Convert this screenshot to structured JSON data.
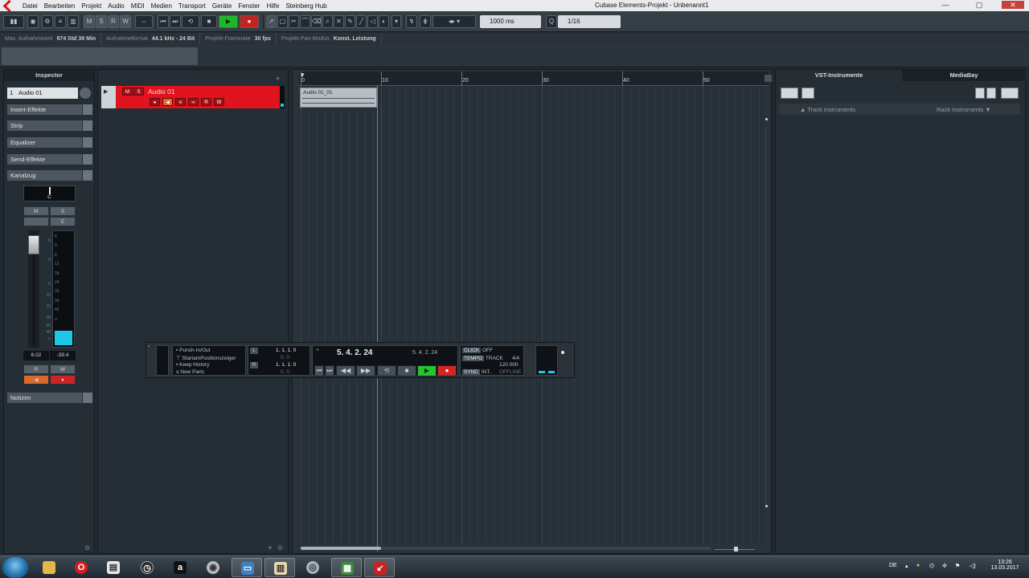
{
  "window": {
    "title": "Cubase Elements-Projekt - Unbenannt1",
    "minimize": "—",
    "maximize": "▢",
    "close": "✕"
  },
  "menu": [
    "Datei",
    "Bearbeiten",
    "Projekt",
    "Audio",
    "MIDI",
    "Medien",
    "Transport",
    "Geräte",
    "Fenster",
    "Hilfe",
    "Steinberg Hub"
  ],
  "toolbar": {
    "m": "M",
    "s": "S",
    "r": "R",
    "w": "W",
    "tempo_field": "1000 ms",
    "quantize_field": "1/16",
    "quantize_icon": "Q"
  },
  "status": [
    {
      "label": "Max. Aufnahmezeit",
      "value": "974 Std 39 Min"
    },
    {
      "label": "Aufnahmeformat",
      "value": "44.1 kHz - 24 Bit"
    },
    {
      "label": "Projekt-Framerate",
      "value": "30 fps"
    },
    {
      "label": "Projekt-Pan-Modus",
      "value": "Konst. Leistung"
    }
  ],
  "inspector": {
    "title": "Inspector",
    "track_number": "1",
    "track_name": "Audio 01",
    "sections": [
      "Insert-Effekte",
      "Strip",
      "Equalizer",
      "Send-Effekte",
      "Kanalzug"
    ],
    "pan_value": "C",
    "m": "M",
    "s": "S",
    "e": "E",
    "scale": [
      "6",
      "0",
      "6",
      "12",
      "18",
      "24",
      "30",
      "36",
      "42",
      "∞"
    ],
    "left_scale": [
      "6",
      "0",
      "5",
      "10",
      "15",
      "20",
      "30",
      "40",
      "∞"
    ],
    "volume": "6.02",
    "peak": "-39.4",
    "r": "R",
    "w": "W",
    "notes": "Notizen"
  },
  "track": {
    "name": "Audio 01",
    "m": "M",
    "s": "S",
    "r": "R",
    "w": "W"
  },
  "ruler": {
    "ticks": [
      "0",
      "10",
      "20",
      "30",
      "40",
      "50"
    ]
  },
  "clip": {
    "name": "Audio 01_01"
  },
  "rightzone": {
    "tabs": [
      "VST-Instrumente",
      "MediaBay"
    ],
    "track_instruments": "▲ Track Instruments",
    "rack_instruments": "Rack Instruments ▼"
  },
  "transport": {
    "options": [
      "Punch-In/Out",
      "StartamPositionszeiger",
      "Keep History",
      "New Parts"
    ],
    "left_locator": "1. 1. 1.   0",
    "left_locator_sub": "0.    0",
    "right_locator": "1. 1. 1.   0",
    "right_locator_sub": "0.    0",
    "l": "L",
    "r": "R",
    "position": "5. 4. 2. 24",
    "position_secondary": "5. 4. 2. 24",
    "click_label": "CLICK",
    "click_value": "OFF",
    "tempo_label": "TEMPO",
    "tempo_mode": "TRACK",
    "signature": "4/4",
    "tempo_value": "120.000",
    "sync_label": "SYNC",
    "sync_mode": "INT.",
    "sync_status": "OFFLINE"
  },
  "taskbar": {
    "lang": "DE",
    "time": "13:26",
    "date": "13.03.2017"
  }
}
